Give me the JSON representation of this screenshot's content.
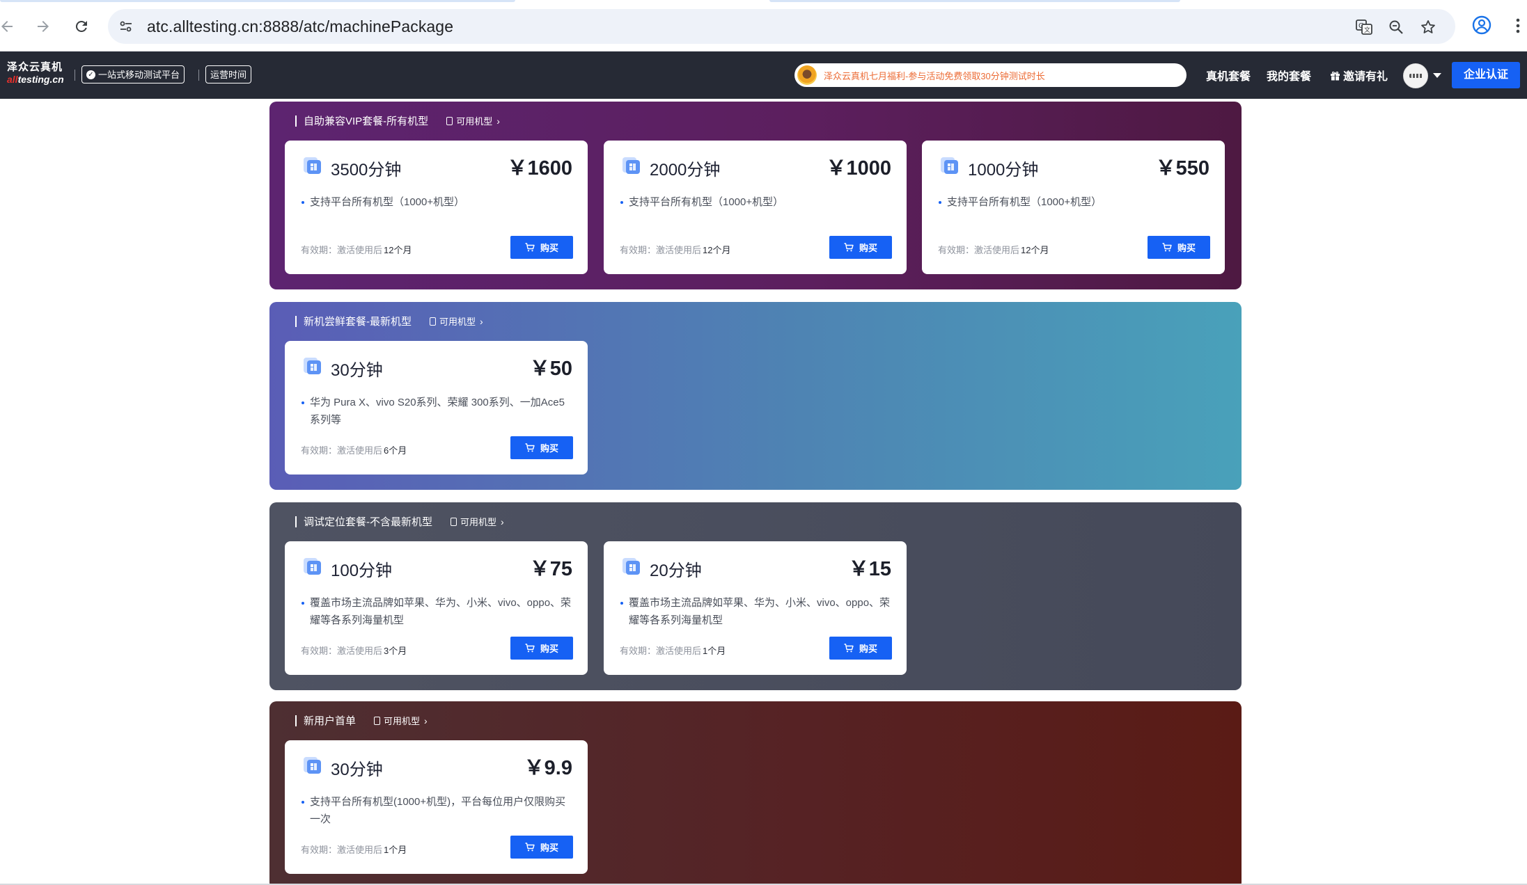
{
  "browser": {
    "url": "atc.alltesting.cn:8888/atc/machinePackage"
  },
  "header": {
    "logo_cn": "泽众云真机",
    "logo_en_red": "all",
    "logo_en_rest": "testing.cn",
    "tag_platform": "一站式移动测试平台",
    "tag_hours": "运营时间",
    "promo_text": "泽众云真机七月福利-参与活动免费领取30分钟测试时长",
    "nav_packages": "真机套餐",
    "nav_my_packages": "我的套餐",
    "nav_invite": "邀请有礼",
    "enterprise_button": "企业认证"
  },
  "common": {
    "available_models": "可用机型",
    "buy_label": "购买",
    "validity_label": "有效期：激活使用后"
  },
  "sections": [
    {
      "title": "自助兼容VIP套餐-所有机型",
      "cards": [
        {
          "minutes": "3500分钟",
          "price": "￥1600",
          "desc": "支持平台所有机型（1000+机型）",
          "validity": "12个月"
        },
        {
          "minutes": "2000分钟",
          "price": "￥1000",
          "desc": "支持平台所有机型（1000+机型）",
          "validity": "12个月"
        },
        {
          "minutes": "1000分钟",
          "price": "￥550",
          "desc": "支持平台所有机型（1000+机型）",
          "validity": "12个月"
        }
      ]
    },
    {
      "title": "新机尝鲜套餐-最新机型",
      "cards": [
        {
          "minutes": "30分钟",
          "price": "￥50",
          "desc": "华为 Pura X、vivo S20系列、荣耀 300系列、一加Ace5系列等",
          "validity": "6个月"
        }
      ]
    },
    {
      "title": "调试定位套餐-不含最新机型",
      "cards": [
        {
          "minutes": "100分钟",
          "price": "￥75",
          "desc": "覆盖市场主流品牌如苹果、华为、小米、vivo、oppo、荣耀等各系列海量机型",
          "validity": "3个月"
        },
        {
          "minutes": "20分钟",
          "price": "￥15",
          "desc": "覆盖市场主流品牌如苹果、华为、小米、vivo、oppo、荣耀等各系列海量机型",
          "validity": "1个月"
        }
      ]
    },
    {
      "title": "新用户首单",
      "cards": [
        {
          "minutes": "30分钟",
          "price": "￥9.9",
          "desc": "支持平台所有机型(1000+机型)，平台每位用户仅限购买一次",
          "validity": "1个月"
        }
      ]
    }
  ],
  "icons": {
    "back": "arrow-left-icon",
    "forward": "arrow-right-icon",
    "reload": "reload-icon",
    "site_info": "tune-icon",
    "translate": "translate-icon",
    "zoom": "zoom-icon",
    "bookmark": "star-icon",
    "profile": "profile-icon",
    "menu": "more-vertical-icon",
    "package": "package-icon",
    "cart": "cart-icon",
    "phone": "phone-icon",
    "gift": "gift-icon"
  },
  "colors": {
    "primary": "#1661f4",
    "header_bg": "#262a35",
    "promo_text": "#ec6b35"
  }
}
